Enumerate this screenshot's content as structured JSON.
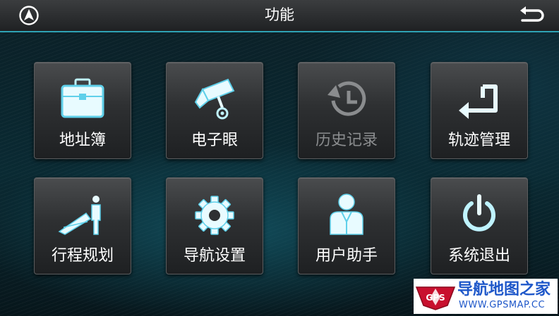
{
  "header": {
    "title": "功能",
    "nav_icon": "compass-arrow-icon",
    "back_icon": "return-arrow-icon"
  },
  "tiles": [
    {
      "label": "地址簿",
      "icon": "briefcase-icon",
      "enabled": true
    },
    {
      "label": "电子眼",
      "icon": "camera-icon",
      "enabled": true
    },
    {
      "label": "历史记录",
      "icon": "history-icon",
      "enabled": false
    },
    {
      "label": "轨迹管理",
      "icon": "track-icon",
      "enabled": true
    },
    {
      "label": "行程规划",
      "icon": "route-plan-icon",
      "enabled": true
    },
    {
      "label": "导航设置",
      "icon": "gear-icon",
      "enabled": true
    },
    {
      "label": "用户助手",
      "icon": "user-assistant-icon",
      "enabled": true
    },
    {
      "label": "系统退出",
      "icon": "power-icon",
      "enabled": true
    }
  ],
  "watermark": {
    "logo_text": "GPS",
    "title": "导航地图之家",
    "url": "WWW.GPSMAP.CC"
  },
  "colors": {
    "accent": "#2ea3b5",
    "icon_glow": "#9fe6f5",
    "disabled": "#8a8c8e",
    "watermark_blue": "#1e57c9"
  }
}
